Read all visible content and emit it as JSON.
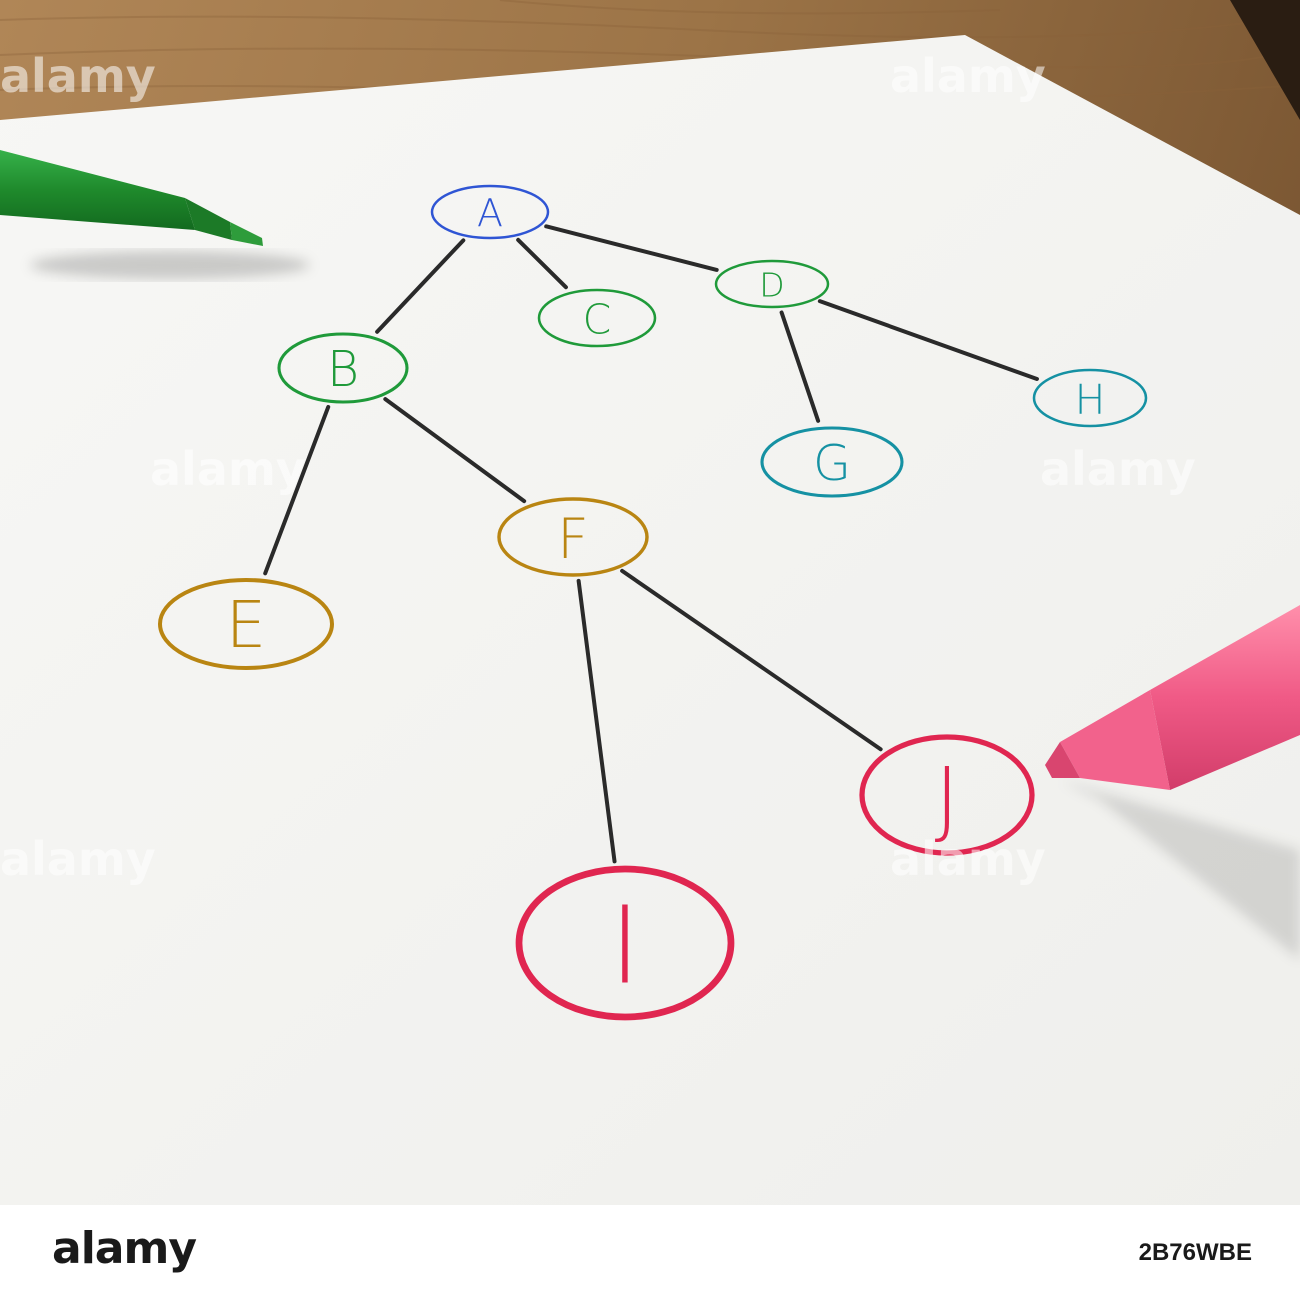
{
  "diagram": {
    "nodes": [
      {
        "id": "A",
        "label": "A",
        "color": "#2f55d4"
      },
      {
        "id": "B",
        "label": "B",
        "color": "#1f9a3a"
      },
      {
        "id": "C",
        "label": "C",
        "color": "#1f9a3a"
      },
      {
        "id": "D",
        "label": "D",
        "color": "#1f9a3a"
      },
      {
        "id": "E",
        "label": "E",
        "color": "#b98512"
      },
      {
        "id": "F",
        "label": "F",
        "color": "#b98512"
      },
      {
        "id": "G",
        "label": "G",
        "color": "#1591a3"
      },
      {
        "id": "H",
        "label": "H",
        "color": "#1591a3"
      },
      {
        "id": "I",
        "label": "I",
        "color": "#e02650"
      },
      {
        "id": "J",
        "label": "J",
        "color": "#e02650"
      }
    ],
    "edges": [
      [
        "A",
        "B"
      ],
      [
        "A",
        "C"
      ],
      [
        "A",
        "D"
      ],
      [
        "B",
        "E"
      ],
      [
        "B",
        "F"
      ],
      [
        "D",
        "G"
      ],
      [
        "D",
        "H"
      ],
      [
        "F",
        "I"
      ],
      [
        "F",
        "J"
      ]
    ]
  },
  "colors": {
    "paper": "#f4f4f2",
    "desk": "#a57c4f",
    "edge": "#2a2a2a",
    "green_marker": "#1f8a2c",
    "pink_marker": "#f05a86"
  },
  "watermark": {
    "text": "alamy"
  },
  "footer": {
    "brand": "alamy",
    "image_id": "2B76WBE"
  }
}
